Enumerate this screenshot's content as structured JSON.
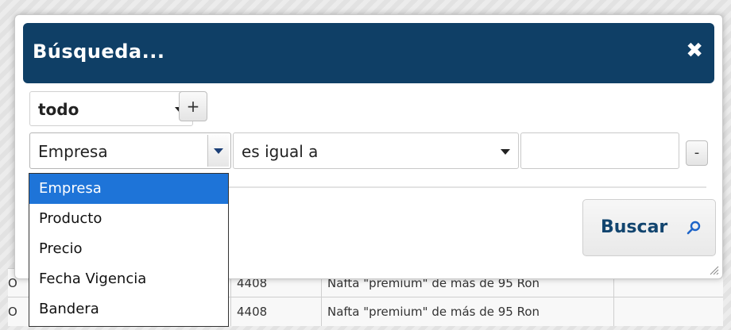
{
  "dialog": {
    "title": "Búsqueda...",
    "close_glyph": "✖"
  },
  "filter": {
    "scope_value": "todo",
    "add_label": "+",
    "field_value": "Empresa",
    "operator_value": "es igual a",
    "value_input": "",
    "remove_label": "-"
  },
  "field_options": [
    "Empresa",
    "Producto",
    "Precio",
    "Fecha Vigencia",
    "Bandera"
  ],
  "search_button": {
    "label": "Buscar",
    "icon": "magnifier-icon"
  },
  "background_rows": [
    {
      "col1": "O",
      "col2": "4408",
      "col3": "Nafta \"premium\" de más de 95 Ron"
    },
    {
      "col1": "O",
      "col2": "4408",
      "col3": "Nafta \"premium\" de más de 95 Ron"
    }
  ],
  "colors": {
    "titlebar": "#0f3f66",
    "accent_selected": "#1e74d8",
    "search_label": "#12456f"
  }
}
